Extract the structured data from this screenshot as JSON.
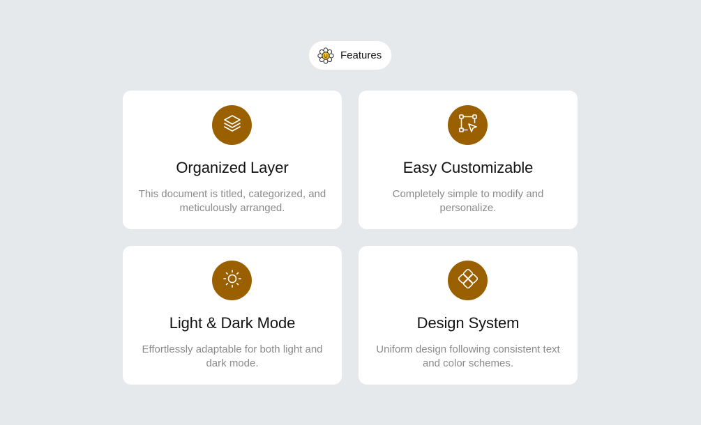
{
  "header": {
    "badge_label": "Features",
    "badge_icon": "daisy-smiley-icon"
  },
  "colors": {
    "background": "#e6e9ec",
    "card": "#ffffff",
    "accent": "#9a6000",
    "title": "#121212",
    "description": "#8a8a8a"
  },
  "features": [
    {
      "icon": "layers-icon",
      "title": "Organized Layer",
      "description": "This document is titled, categorized, and meticulously arranged."
    },
    {
      "icon": "vector-select-icon",
      "title": "Easy Customizable",
      "description": "Completely simple to modify and personalize."
    },
    {
      "icon": "sun-icon",
      "title": "Light & Dark Mode",
      "description": "Effortlessly adaptable for both light and dark mode."
    },
    {
      "icon": "components-icon",
      "title": "Design System",
      "description": "Uniform design following consistent text and color schemes."
    }
  ]
}
